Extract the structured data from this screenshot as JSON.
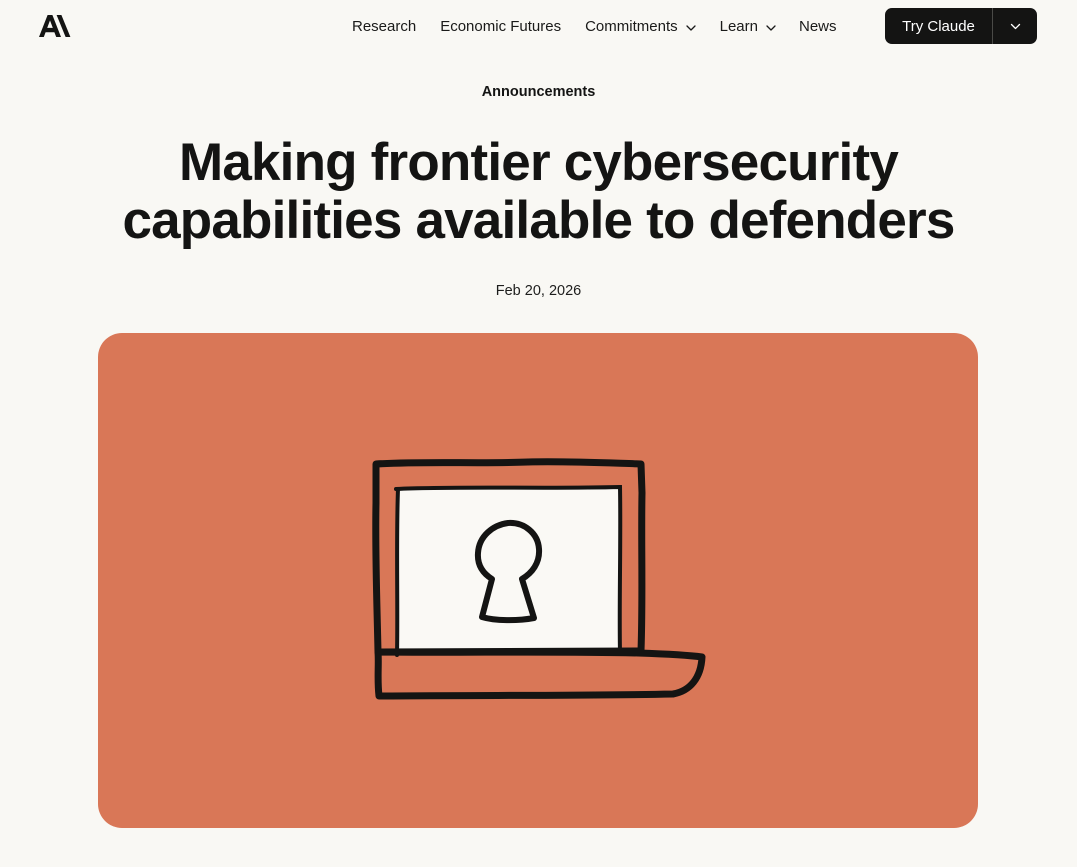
{
  "header": {
    "logo_icon": "anthropic-logo-icon",
    "nav": [
      {
        "label": "Research",
        "has_dropdown": false
      },
      {
        "label": "Economic Futures",
        "has_dropdown": false
      },
      {
        "label": "Commitments",
        "has_dropdown": true
      },
      {
        "label": "Learn",
        "has_dropdown": true
      },
      {
        "label": "News",
        "has_dropdown": false
      }
    ],
    "cta": {
      "label": "Try Claude",
      "dropdown_icon": "chevron-down-icon"
    }
  },
  "article": {
    "category": "Announcements",
    "title_lines": [
      "Making frontier cybersecurity",
      "capabilities available to defenders"
    ],
    "date": "Feb 20, 2026",
    "hero": {
      "icon": "laptop-keyhole-illustration",
      "background_color": "#d97757"
    }
  },
  "colors": {
    "page_background": "#f9f8f4",
    "text": "#141413",
    "button_background": "#141413",
    "accent": "#d97757"
  }
}
